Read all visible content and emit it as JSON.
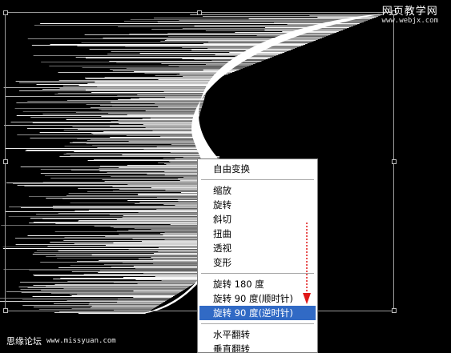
{
  "watermark": {
    "site_cn": "网页教学网",
    "site_url": "www.webjx.com",
    "forum_cn": "思缘论坛",
    "forum_url": "www.missyuan.com"
  },
  "context_menu": {
    "items": [
      {
        "label": "自由变换"
      },
      {
        "sep": true
      },
      {
        "label": "缩放"
      },
      {
        "label": "旋转"
      },
      {
        "label": "斜切"
      },
      {
        "label": "扭曲"
      },
      {
        "label": "透视"
      },
      {
        "label": "变形"
      },
      {
        "sep": true
      },
      {
        "label": "旋转 180 度"
      },
      {
        "label": "旋转 90 度(顺时针)"
      },
      {
        "label": "旋转 90 度(逆时针)",
        "selected": true
      },
      {
        "sep": true
      },
      {
        "label": "水平翻转"
      },
      {
        "label": "垂直翻转"
      }
    ]
  },
  "colors": {
    "background": "#000000",
    "menu_background": "#ffffff",
    "menu_highlight": "#316ac5",
    "arrow": "#e01818",
    "handle_border": "#bdbdbd"
  },
  "icons": {
    "annotation_arrow": "dotted-red-down-arrow",
    "transform_handle": "square-handle"
  }
}
